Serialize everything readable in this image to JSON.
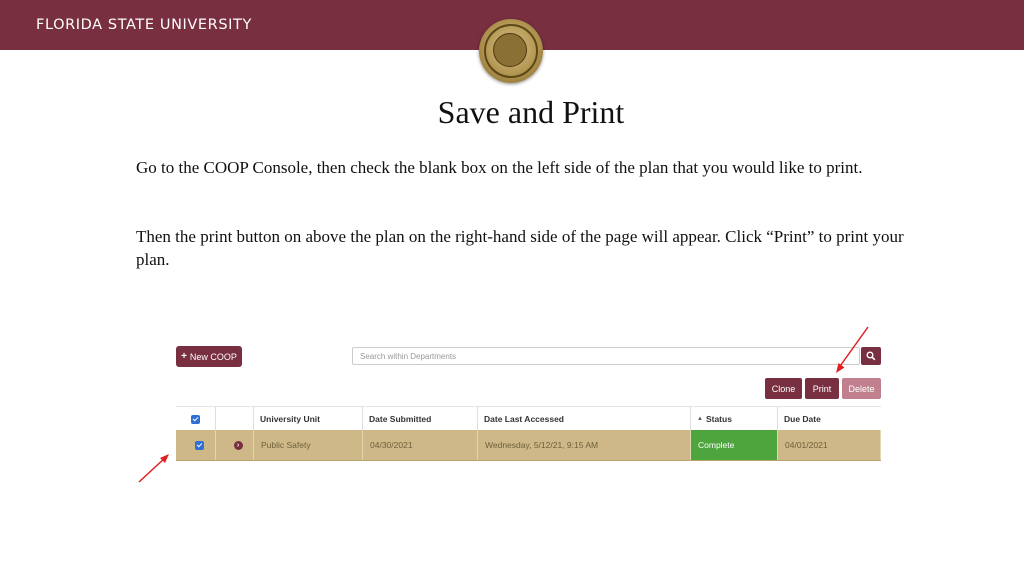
{
  "header": {
    "title": "FLORIDA STATE UNIVERSITY",
    "seal_icon": "university-seal-icon",
    "color": "#782f40"
  },
  "slide": {
    "title": "Save and Print",
    "paragraph1": "Go to the COOP Console, then check the blank box on the left side of the plan that you would like to print.",
    "paragraph2": "Then the print button on above the plan on the right-hand side of the page will appear. Click “Print” to print your plan."
  },
  "console": {
    "new_coop_label": "New COOP",
    "search_placeholder": "Search within Departments",
    "actions": {
      "clone": "Clone",
      "print": "Print",
      "delete": "Delete"
    },
    "table": {
      "headers": {
        "unit": "University Unit",
        "submitted": "Date Submitted",
        "accessed": "Date Last Accessed",
        "status": "Status",
        "due": "Due Date"
      },
      "rows": [
        {
          "unit": "Public Safety",
          "submitted": "04/30/2021",
          "accessed": "Wednesday, 5/12/21, 9:15 AM",
          "status": "Complete",
          "due": "04/01/2021",
          "checked": true
        }
      ]
    },
    "colors": {
      "brand": "#782f40",
      "row_highlight": "#ceb888",
      "status_complete": "#4ea43d",
      "checkbox": "#2f6fd6",
      "annotation_arrow": "#e02020"
    }
  }
}
